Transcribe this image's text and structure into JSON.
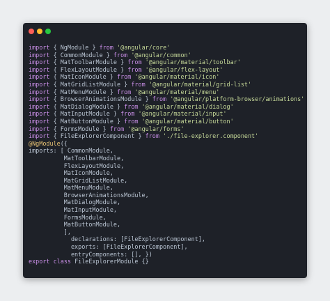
{
  "window": {
    "traffic_lights": [
      {
        "name": "close",
        "color": "#fe5f57"
      },
      {
        "name": "minimize",
        "color": "#febc2e"
      },
      {
        "name": "maximize",
        "color": "#28c840"
      }
    ]
  },
  "colors": {
    "page_background": "#eceef0",
    "window_background": "#1e2128",
    "plain_text": "#b9c4d2",
    "keyword": "#c88ee6",
    "string": "#c6d999",
    "decorator": "#e6c173"
  },
  "code_lines": [
    [
      {
        "t": "import",
        "c": "kw"
      },
      {
        "t": " { NgModule } ",
        "c": "pl"
      },
      {
        "t": "from",
        "c": "kw"
      },
      {
        "t": " ",
        "c": "pl"
      },
      {
        "t": "'@angular/core'",
        "c": "str"
      }
    ],
    [
      {
        "t": "import",
        "c": "kw"
      },
      {
        "t": " { CommonModule } ",
        "c": "pl"
      },
      {
        "t": "from",
        "c": "kw"
      },
      {
        "t": " ",
        "c": "pl"
      },
      {
        "t": "'@angular/common'",
        "c": "str"
      }
    ],
    [
      {
        "t": "import",
        "c": "kw"
      },
      {
        "t": " { MatToolbarModule } ",
        "c": "pl"
      },
      {
        "t": "from",
        "c": "kw"
      },
      {
        "t": " ",
        "c": "pl"
      },
      {
        "t": "'@angular/material/toolbar'",
        "c": "str"
      }
    ],
    [
      {
        "t": "import",
        "c": "kw"
      },
      {
        "t": " { FlexLayoutModule } ",
        "c": "pl"
      },
      {
        "t": "from",
        "c": "kw"
      },
      {
        "t": " ",
        "c": "pl"
      },
      {
        "t": "'@angular/flex-layout'",
        "c": "str"
      }
    ],
    [
      {
        "t": "import",
        "c": "kw"
      },
      {
        "t": " { MatIconModule } ",
        "c": "pl"
      },
      {
        "t": "from",
        "c": "kw"
      },
      {
        "t": " ",
        "c": "pl"
      },
      {
        "t": "'@angular/material/icon'",
        "c": "str"
      }
    ],
    [
      {
        "t": "import",
        "c": "kw"
      },
      {
        "t": " { MatGridListModule } ",
        "c": "pl"
      },
      {
        "t": "from",
        "c": "kw"
      },
      {
        "t": " ",
        "c": "pl"
      },
      {
        "t": "'@angular/material/grid-list'",
        "c": "str"
      }
    ],
    [
      {
        "t": "import",
        "c": "kw"
      },
      {
        "t": " { MatMenuModule } ",
        "c": "pl"
      },
      {
        "t": "from",
        "c": "kw"
      },
      {
        "t": " ",
        "c": "pl"
      },
      {
        "t": "'@angular/material/menu'",
        "c": "str"
      }
    ],
    [
      {
        "t": "import",
        "c": "kw"
      },
      {
        "t": " { BrowserAnimationsModule } ",
        "c": "pl"
      },
      {
        "t": "from",
        "c": "kw"
      },
      {
        "t": " ",
        "c": "pl"
      },
      {
        "t": "'@angular/platform-browser/animations'",
        "c": "str"
      }
    ],
    [
      {
        "t": "import",
        "c": "kw"
      },
      {
        "t": " { MatDialogModule } ",
        "c": "pl"
      },
      {
        "t": "from",
        "c": "kw"
      },
      {
        "t": " ",
        "c": "pl"
      },
      {
        "t": "'@angular/material/dialog'",
        "c": "str"
      }
    ],
    [
      {
        "t": "import",
        "c": "kw"
      },
      {
        "t": " { MatInputModule } ",
        "c": "pl"
      },
      {
        "t": "from",
        "c": "kw"
      },
      {
        "t": " ",
        "c": "pl"
      },
      {
        "t": "'@angular/material/input'",
        "c": "str"
      }
    ],
    [
      {
        "t": "import",
        "c": "kw"
      },
      {
        "t": " { MatButtonModule } ",
        "c": "pl"
      },
      {
        "t": "from",
        "c": "kw"
      },
      {
        "t": " ",
        "c": "pl"
      },
      {
        "t": "'@angular/material/button'",
        "c": "str"
      }
    ],
    [
      {
        "t": "import",
        "c": "kw"
      },
      {
        "t": " { FormsModule } ",
        "c": "pl"
      },
      {
        "t": "from",
        "c": "kw"
      },
      {
        "t": " ",
        "c": "pl"
      },
      {
        "t": "'@angular/forms'",
        "c": "str"
      }
    ],
    [
      {
        "t": "import",
        "c": "kw"
      },
      {
        "t": " { FileExplorerComponent } ",
        "c": "pl"
      },
      {
        "t": "from",
        "c": "kw"
      },
      {
        "t": " ",
        "c": "pl"
      },
      {
        "t": "'./file-explorer.component'",
        "c": "str"
      }
    ],
    [
      {
        "t": "@NgModule",
        "c": "dec"
      },
      {
        "t": "({",
        "c": "pl"
      }
    ],
    [
      {
        "t": "imports: [ CommonModule,",
        "c": "pl"
      }
    ],
    [
      {
        "t": "          MatToolbarModule,",
        "c": "pl"
      }
    ],
    [
      {
        "t": "          FlexLayoutModule,",
        "c": "pl"
      }
    ],
    [
      {
        "t": "          MatIconModule,",
        "c": "pl"
      }
    ],
    [
      {
        "t": "          MatGridListModule,",
        "c": "pl"
      }
    ],
    [
      {
        "t": "          MatMenuModule,",
        "c": "pl"
      }
    ],
    [
      {
        "t": "          BrowserAnimationsModule,",
        "c": "pl"
      }
    ],
    [
      {
        "t": "          MatDialogModule,",
        "c": "pl"
      }
    ],
    [
      {
        "t": "          MatInputModule,",
        "c": "pl"
      }
    ],
    [
      {
        "t": "          FormsModule,",
        "c": "pl"
      }
    ],
    [
      {
        "t": "          MatButtonModule,",
        "c": "pl"
      }
    ],
    [
      {
        "t": "          ],",
        "c": "pl"
      }
    ],
    [
      {
        "t": "            declarations: [FileExplorerComponent],",
        "c": "pl"
      }
    ],
    [
      {
        "t": "            exports: [FileExplorerComponent],",
        "c": "pl"
      }
    ],
    [
      {
        "t": "            entryComponents: [], })",
        "c": "pl"
      }
    ],
    [
      {
        "t": "export",
        "c": "kw"
      },
      {
        "t": " ",
        "c": "pl"
      },
      {
        "t": "class",
        "c": "kw"
      },
      {
        "t": " FileExplorerModule {}",
        "c": "pl"
      }
    ]
  ]
}
